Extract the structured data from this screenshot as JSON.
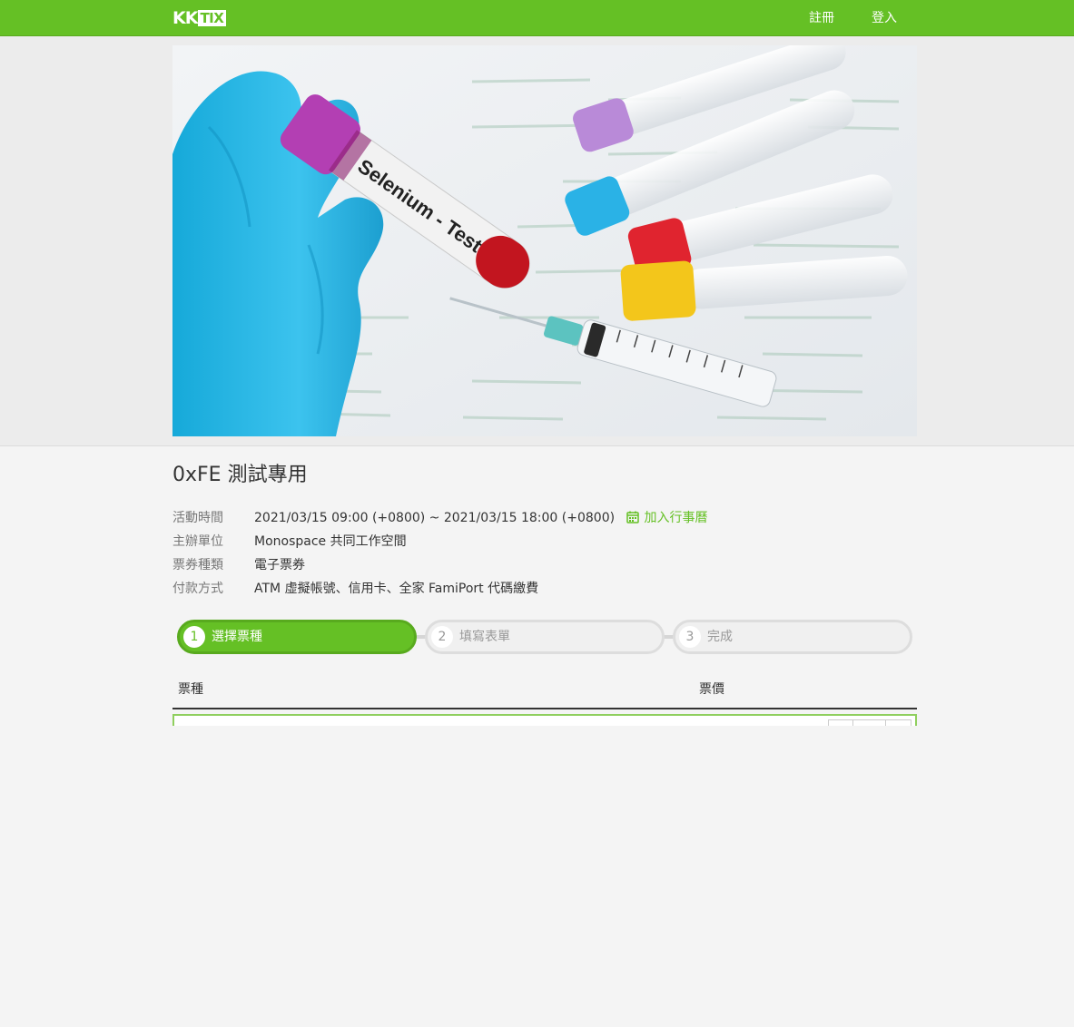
{
  "header": {
    "logo_prefix": "KK",
    "logo_box": "TIX",
    "register_label": "註冊",
    "login_label": "登入"
  },
  "banner": {
    "tube_label": "Selenium - Test"
  },
  "event": {
    "title": "0xFE 測試專用",
    "time_label": "活動時間",
    "time_value": "2021/03/15 09:00 (+0800) ~ 2021/03/15 18:00 (+0800)",
    "add_calendar": "加入行事曆",
    "organizer_label": "主辦單位",
    "organizer_value": "Monospace 共同工作空間",
    "ticket_type_label": "票券種類",
    "ticket_type_value": "電子票券",
    "payment_label": "付款方式",
    "payment_value": "ATM 虛擬帳號、信用卡、全家 FamiPort 代碼繳費"
  },
  "steps": [
    {
      "num": "1",
      "label": "選擇票種",
      "active": true
    },
    {
      "num": "2",
      "label": "填寫表單",
      "active": false
    },
    {
      "num": "3",
      "label": "完成",
      "active": false
    }
  ],
  "ticket_table": {
    "col_type": "票種",
    "col_price": "票價"
  },
  "colors": {
    "brand": "#65c025",
    "step_active_border": "#58aa1e"
  },
  "icons": {
    "calendar": "calendar-icon"
  }
}
